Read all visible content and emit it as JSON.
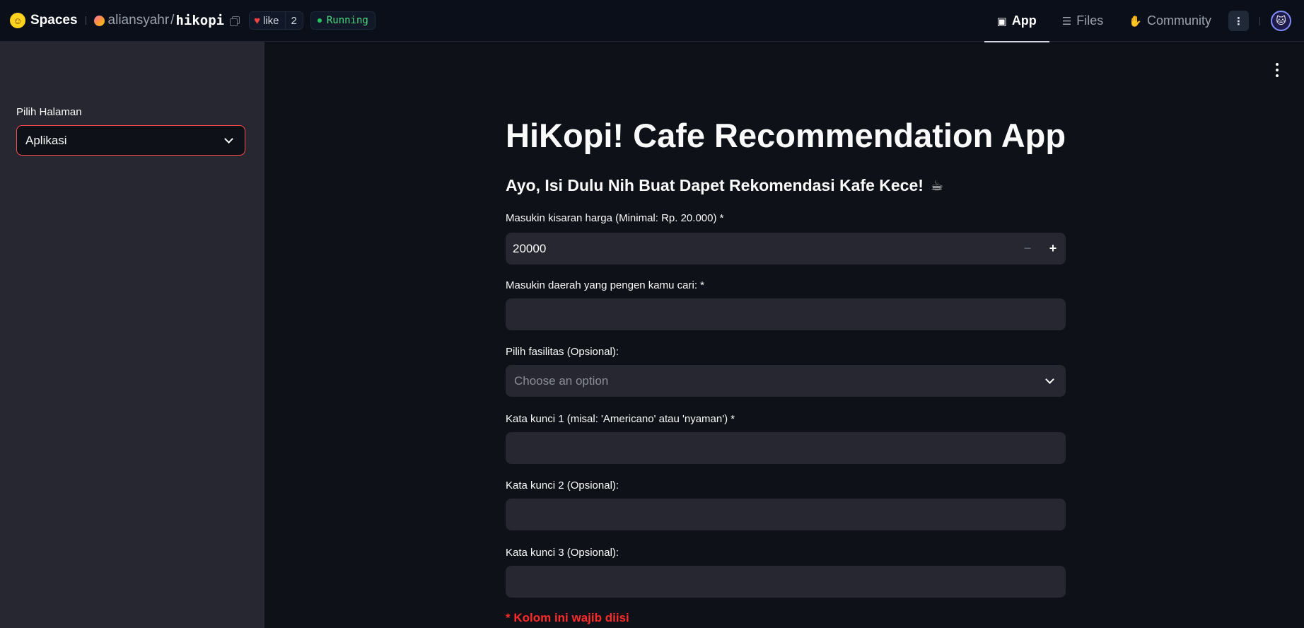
{
  "topbar": {
    "spaces_label": "Spaces",
    "owner": "aliansyahr",
    "separator": "/",
    "repo": "hikopi",
    "like_label": "like",
    "like_count": "2",
    "status": "Running",
    "tabs": [
      {
        "label": "App",
        "icon": "cube-icon",
        "active": true
      },
      {
        "label": "Files",
        "icon": "files-icon",
        "active": false
      },
      {
        "label": "Community",
        "icon": "community-icon",
        "active": false
      }
    ]
  },
  "sidebar": {
    "label": "Pilih Halaman",
    "selected": "Aplikasi"
  },
  "main": {
    "title": "HiKopi! Cafe Recommendation App",
    "subtitle": "Ayo, Isi Dulu Nih Buat Dapet Rekomendasi Kafe Kece!",
    "price": {
      "label": "Masukin kisaran harga (Minimal: Rp. 20.000) *",
      "value": "20000",
      "minus": "−",
      "plus": "+"
    },
    "area": {
      "label": "Masukin daerah yang pengen kamu cari: *",
      "value": ""
    },
    "facilities": {
      "label": "Pilih fasilitas (Opsional):",
      "placeholder": "Choose an option"
    },
    "keyword1": {
      "label": "Kata kunci 1 (misal: 'Americano' atau 'nyaman') *",
      "value": ""
    },
    "keyword2": {
      "label": "Kata kunci 2 (Opsional):",
      "value": ""
    },
    "keyword3": {
      "label": "Kata kunci 3 (Opsional):",
      "value": ""
    },
    "required_note": "* Kolom ini wajib diisi"
  },
  "colors": {
    "accent": "#ff4b4b",
    "background": "#0e1117",
    "sidebar": "#262730",
    "status": "#22c55e"
  }
}
